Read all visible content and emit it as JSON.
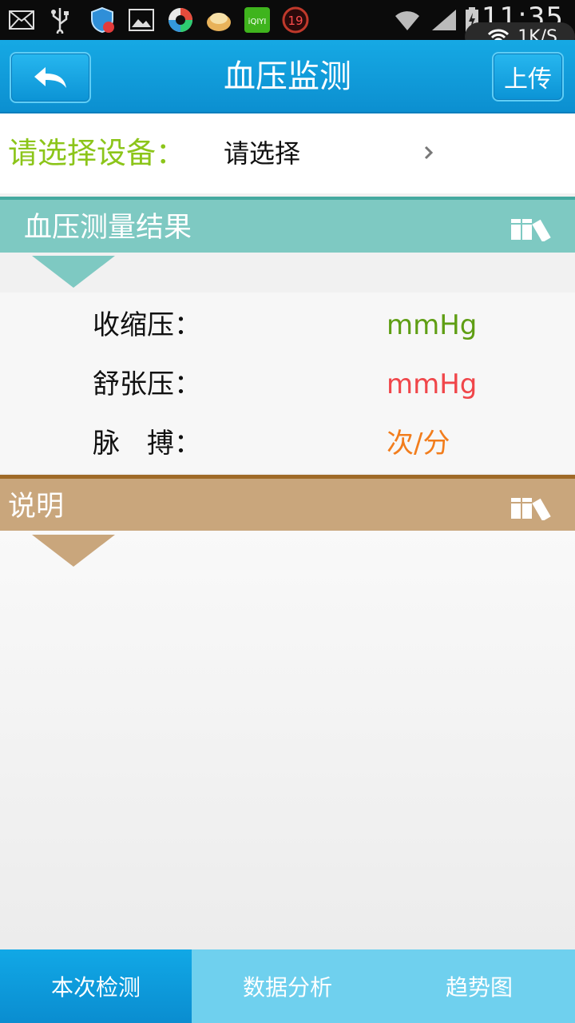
{
  "status_bar": {
    "time": "11:35",
    "net_speed": "1K/S",
    "notification_icons": [
      "mail-icon",
      "usb-icon",
      "shield-icon",
      "gallery-icon",
      "app-icon",
      "food-icon",
      "iqiyi-icon",
      "calendar-19-icon"
    ],
    "calendar_badge": "19",
    "iqiyi_badge": "iQIYI"
  },
  "header": {
    "title": "血压监测",
    "upload_label": "上传",
    "accent": "#0c8fd0"
  },
  "device": {
    "label": "请选择设备：",
    "value": "请选择"
  },
  "result_section": {
    "title": "血压测量结果",
    "rows": [
      {
        "label": "收缩压：",
        "unit": "mmHg",
        "color": "#5f9e14"
      },
      {
        "label": "舒张压：",
        "unit": "mmHg",
        "color": "#f0464a"
      },
      {
        "label": "脉　搏：",
        "unit": "次/分",
        "color": "#f27d1c"
      }
    ]
  },
  "note_section": {
    "title": "说明"
  },
  "tabs": [
    {
      "label": "本次检测",
      "active": true
    },
    {
      "label": "数据分析",
      "active": false
    },
    {
      "label": "趋势图",
      "active": false
    }
  ]
}
